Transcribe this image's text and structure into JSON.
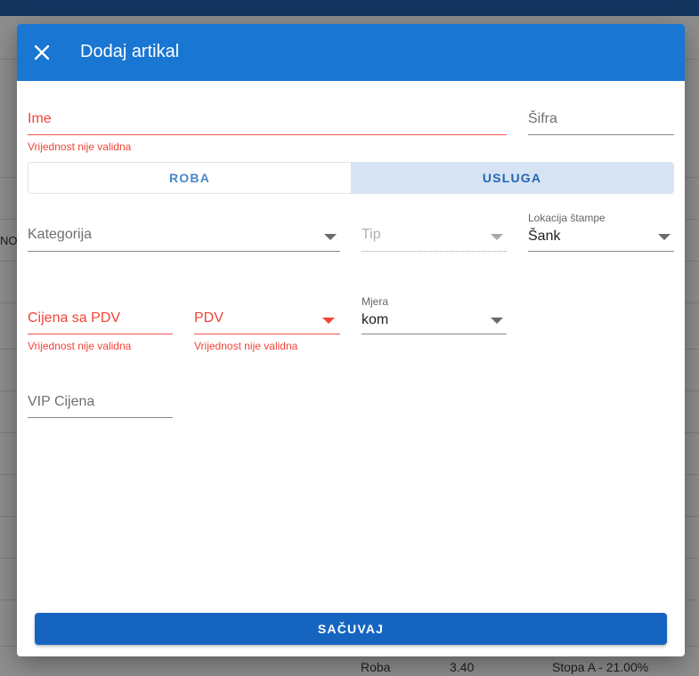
{
  "dialog": {
    "title": "Dodaj artikal",
    "close_icon": "close-icon",
    "save_label": "SAČUVAJ"
  },
  "form": {
    "ime": {
      "label": "Ime",
      "error": "Vrijednost nije validna"
    },
    "sifra": {
      "label": "Šifra"
    },
    "type_toggle": {
      "options": [
        "ROBA",
        "USLUGA"
      ],
      "selected": "USLUGA"
    },
    "kategorija": {
      "label": "Kategorija"
    },
    "tip": {
      "label": "Tip"
    },
    "lokacija_stampe": {
      "label": "Lokacija štampe",
      "value": "Šank"
    },
    "cijena_sa_pdv": {
      "label": "Cijena sa PDV",
      "error": "Vrijednost nije validna"
    },
    "pdv": {
      "label": "PDV",
      "error": "Vrijednost nije validna"
    },
    "mjera": {
      "label": "Mjera",
      "value": "kom"
    },
    "vip_cijena": {
      "label": "VIP Cijena"
    }
  },
  "background": {
    "left_fragment": "NOJ",
    "bottom_row": {
      "type": "Roba",
      "price": "3.40",
      "tax": "Stopa A - 21.00%"
    }
  },
  "colors": {
    "accent": "#1976d2",
    "error": "#f44336",
    "toggle_selected_bg": "#d7e3f3"
  }
}
